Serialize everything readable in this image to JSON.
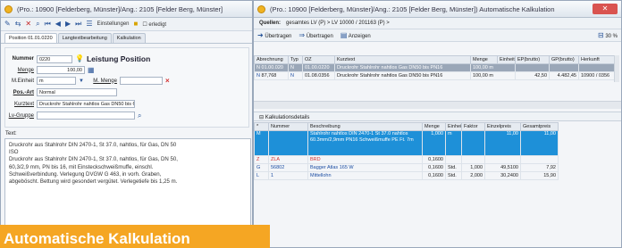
{
  "left": {
    "title": "(Pro.: 10900 [Felderberg, Münster]/Ang.: 2105 [Felder Berg, Münster]",
    "toolbar": {
      "einstellungen": "Einstellungen",
      "erledigt": "erledigt"
    },
    "tabs": [
      "Position 01.01.0220",
      "Langtextbearbeitung",
      "Kalkulation"
    ],
    "form": {
      "nummer_label": "Nummer",
      "nummer_value": "0220",
      "leistung_label": "Leistung Position",
      "menge_label": "Menge",
      "menge_value": "100,00",
      "meinheit_label": "M.Einheit",
      "meinheit_value": "m",
      "mengel_label": "M. Menge",
      "posart_label": "Pos.-Art",
      "posart_value": "Normal",
      "kurztext_label": "Kurztext",
      "kurztext_value": "Druckrohr Stahlrohr nahtlos Gas DN50 bis 6",
      "lvgruppe_label": "Lv-Gruppe"
    },
    "text_label": "Text:",
    "text_lines": [
      "Druckrohr aus Stahlrohr DIN 2470-1, St 37.0, nahtlos, für Gas, DN 50",
      "ISO",
      "Druckrohr aus Stahlrohr DIN 2470-1, St 37.0, nahtlos, für Gas, DN 50,",
      "60,3/2,9 mm, PN bis 16, mit Einsteckschweißmuffe, einschl.",
      "Schweißverbindung. Verlegung DVGW G 463, in vorh. Graben,",
      "abgeböscht. Bettung wird gesondert vergütet. Verlegetiefe bis 1,25 m."
    ]
  },
  "banner": "Automatische Kalkulation",
  "right": {
    "title": "(Pro.: 10900 [Felderberg, Münster]/Ang.: 2105 [Felder Berg, Münster]) Automatische Kalkulation",
    "quelle_label": "Quellen:",
    "quelle_value": "gesamtes LV (P) > LV 10000 / 201163 (P) >",
    "toolbar": {
      "uebertragen": "Übertragen",
      "uebertragen_all": "Übertragen",
      "anzeigen": "Anzeigen",
      "percent": "30 %"
    },
    "top_table": {
      "headers": [
        "Abrechnung",
        "Typ",
        "OZ",
        "Kurztext",
        "Menge",
        "Einheit",
        "EP(brutto)",
        "GP(brutto)",
        "Herkunft"
      ],
      "rows": [
        [
          "N",
          "01.00.020",
          "N",
          "01.00.0220",
          "Druckrohr Stahlrohr nahtlos Gas DN50 bis PN16",
          "100,00 m",
          "",
          "",
          ""
        ],
        [
          "N",
          "87,768",
          "N",
          "01.08.0356",
          "Druckrohr Stahlrohr nahtlos Gas DN50 bis PN16",
          "100,00 m",
          "42,50",
          "4.482,45",
          "10900 / 0356"
        ]
      ]
    },
    "section_label": "Kalkulationsdetails",
    "bottom_table": {
      "headers": [
        "*",
        "Nummer",
        "Beschreibung",
        "Menge",
        "Einheit",
        "Faktor",
        "Einzelpreis",
        "Gesamtpreis"
      ],
      "rows": [
        {
          "t": "M",
          "n": "",
          "d": "Stahlrohr nahtlos DIN 2470-1 St 37.0 nahtlos 60.3mm/2,9mm PN16 Schweißmuffe PE Ft. 7m",
          "m": "1,000",
          "e": "m",
          "f": "",
          "ep": "11,00",
          "gp": "11,00"
        },
        {
          "t": "Z",
          "n": "ZLA",
          "d": "BRD",
          "m": "0,1600",
          "e": "",
          "f": "",
          "ep": "",
          "gp": ""
        },
        {
          "t": "G",
          "n": "56802",
          "d": "Bagger Atlas 165 W",
          "m": "0,1600",
          "e": "Std.",
          "f": "1,000",
          "ep": "49,5100",
          "gp": "7,92"
        },
        {
          "t": "L",
          "n": "1",
          "d": "Mittellohn",
          "m": "0,1600",
          "e": "Std.",
          "f": "2,000",
          "ep": "30,2400",
          "gp": "15,90"
        }
      ]
    }
  }
}
